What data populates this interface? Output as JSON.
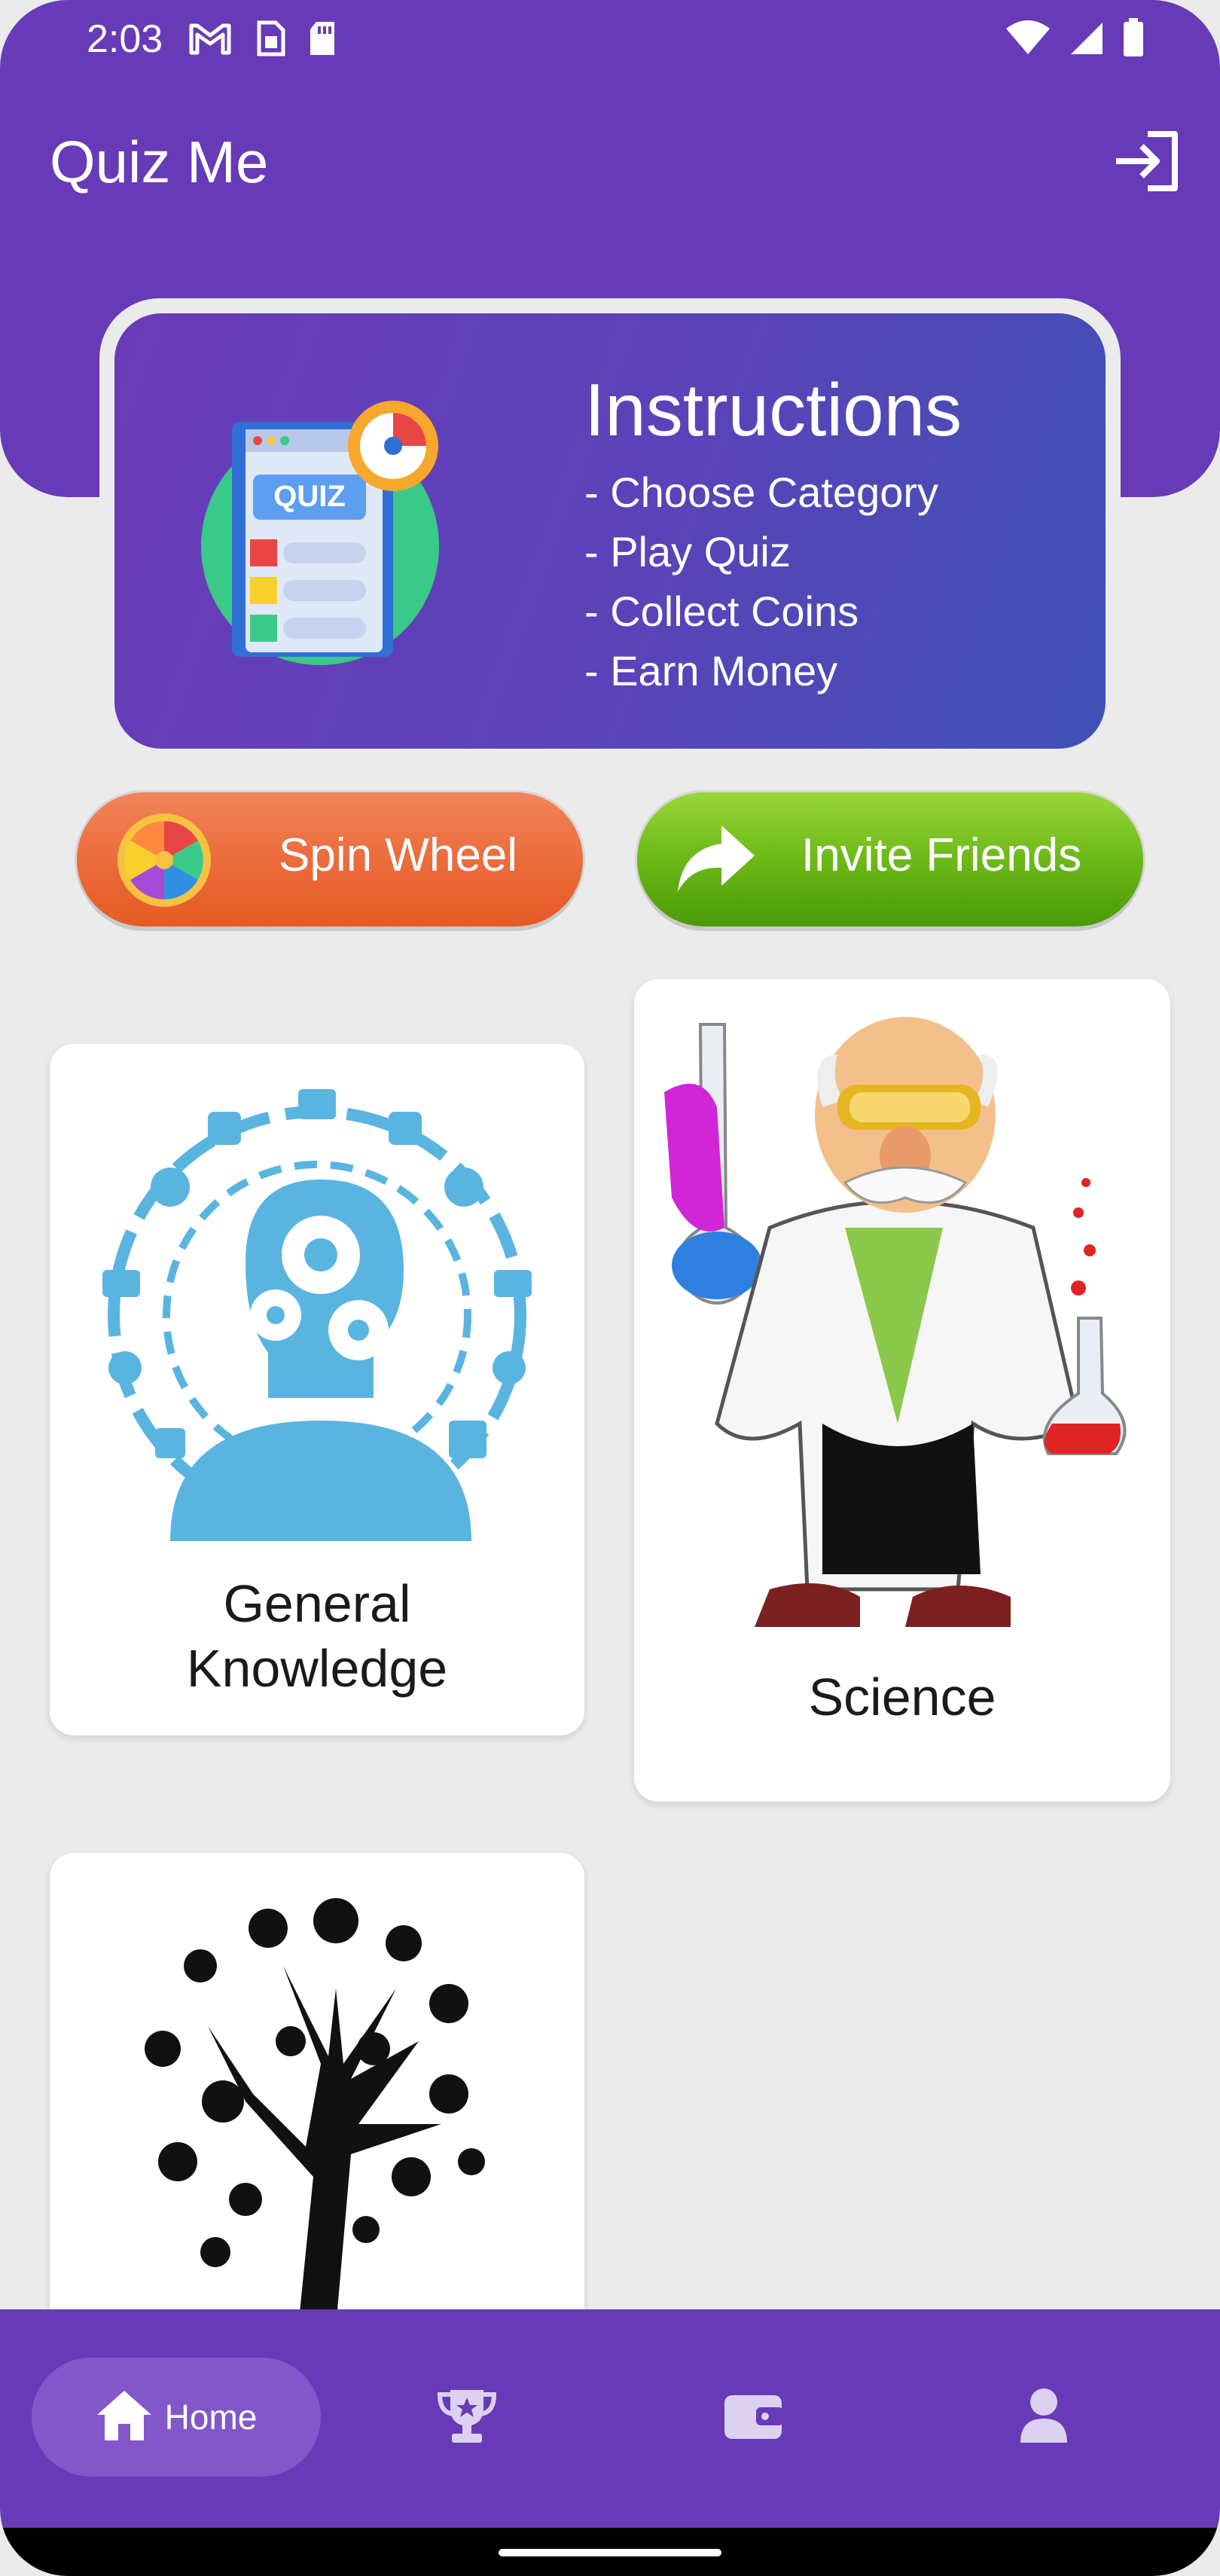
{
  "status_bar": {
    "time": "2:03",
    "icons_left": [
      "gmail-icon",
      "sim-icon",
      "sd-card-icon"
    ],
    "icons_right": [
      "wifi-icon",
      "signal-icon",
      "battery-icon"
    ]
  },
  "header": {
    "title": "Quiz Me",
    "logout_icon": "logout-icon"
  },
  "instructions": {
    "title": "Instructions",
    "items": [
      "- Choose Category",
      "- Play Quiz",
      "- Collect Coins",
      "- Earn Money"
    ],
    "illustration_text": "QUIZ"
  },
  "actions": {
    "spin_label": "Spin Wheel",
    "invite_label": "Invite Friends"
  },
  "categories": [
    {
      "label_line1": "General",
      "label_line2": "Knowledge"
    },
    {
      "label": "Science"
    },
    {
      "label": ""
    }
  ],
  "bottom_nav": {
    "home_label": "Home",
    "items": [
      "home-icon",
      "trophy-icon",
      "wallet-icon",
      "profile-icon"
    ]
  },
  "colors": {
    "primary": "#673ab7",
    "spin": "#ec6e3f",
    "invite": "#6cb917",
    "background": "#ebebeb"
  }
}
